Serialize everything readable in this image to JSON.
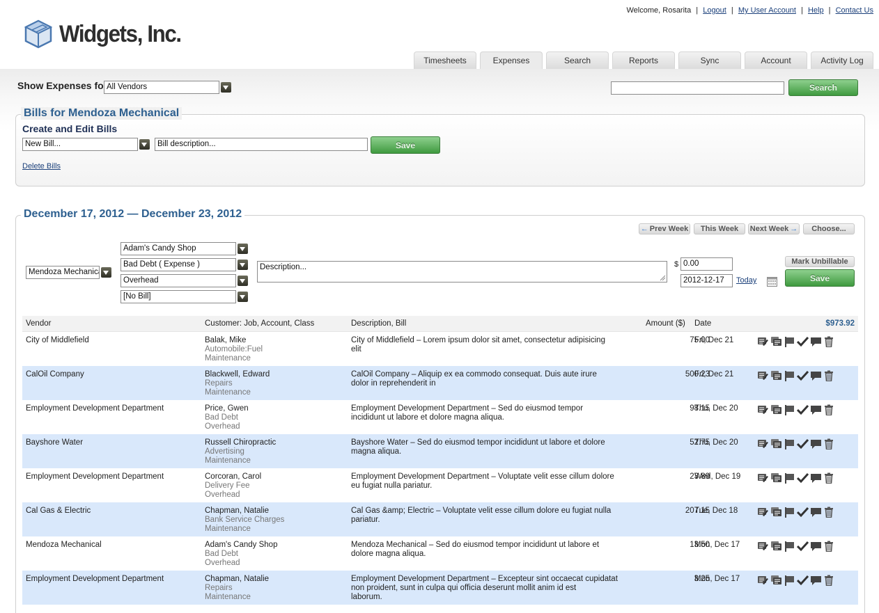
{
  "header": {
    "brand": "Widgets, Inc.",
    "welcome": "Welcome, Rosarita",
    "links": [
      "Logout",
      "My User Account",
      "Help",
      "Contact Us"
    ],
    "tabs": [
      "Timesheets",
      "Expenses",
      "Search",
      "Reports",
      "Sync",
      "Account",
      "Activity Log"
    ],
    "active_tab": "Expenses"
  },
  "filter": {
    "label": "Show Expenses for",
    "vendor_value": "All Vendors",
    "search_value": "",
    "search_button": "Search"
  },
  "bills": {
    "title": "Bills for Mendoza Mechanical",
    "subtitle": "Create and Edit Bills",
    "bill_select": "New Bill...",
    "description_placeholder": "Bill description...",
    "save_button": "Save",
    "delete_link": "Delete Bills"
  },
  "week": {
    "title": "December 17, 2012 — December 23, 2012",
    "prev": "Prev Week",
    "this": "This Week",
    "next": "Next Week",
    "choose": "Choose..."
  },
  "entry": {
    "vendor": "Mendoza Mechanical",
    "customer": "Adam's Candy Shop",
    "account": "Bad Debt ( Expense )",
    "class": "Overhead",
    "bill": "[No Bill]",
    "description_placeholder": "Description...",
    "currency": "$",
    "amount": "0.00",
    "date": "2012-12-17",
    "today": "Today",
    "mark_unbillable": "Mark Unbillable",
    "save": "Save"
  },
  "table": {
    "headers": {
      "vendor": "Vendor",
      "customer": "Customer: Job, Account, Class",
      "description": "Description, Bill",
      "amount": "Amount ($)",
      "date": "Date",
      "total": "$973.92"
    },
    "rows": [
      {
        "vendor": "City of Middlefield",
        "customer": "Balak, Mike",
        "account": "Automobile:Fuel",
        "class": "Maintenance",
        "desc1": "City of Middlefield – Lorem ipsum dolor sit amet, consectetur adipisicing",
        "desc2": "elit",
        "desc3": "",
        "amount": "75.00",
        "date": "Fri, Dec 21"
      },
      {
        "vendor": "CalOil Company",
        "customer": "Blackwell, Edward",
        "account": "Repairs",
        "class": "Maintenance",
        "desc1": "CalOil Company – Aliquip ex ea commodo consequat. Duis aute irure",
        "desc2": "dolor in reprehenderit in",
        "desc3": "",
        "amount": "500.23",
        "date": "Fri, Dec 21"
      },
      {
        "vendor": "Employment Development Department",
        "customer": "Price, Gwen",
        "account": "Bad Debt",
        "class": "Overhead",
        "desc1": "Employment Development Department – Sed do eiusmod tempor",
        "desc2": "incididunt ut labore et dolore magna aliqua.",
        "desc3": "",
        "amount": "98.15",
        "date": "Thu, Dec 20"
      },
      {
        "vendor": "Bayshore Water",
        "customer": "Russell Chiropractic",
        "account": "Advertising",
        "class": "Maintenance",
        "desc1": "Bayshore Water – Sed do eiusmod tempor incididunt ut labore et dolore",
        "desc2": "magna aliqua.",
        "desc3": "",
        "amount": "52.75",
        "date": "Thu, Dec 20"
      },
      {
        "vendor": "Employment Development Department",
        "customer": "Corcoran, Carol",
        "account": "Delivery Fee",
        "class": "Overhead",
        "desc1": "Employment Development Department – Voluptate velit esse cillum dolore",
        "desc2": "eu fugiat nulla pariatur.",
        "desc3": "",
        "amount": "23.89",
        "date": "Wed, Dec 19"
      },
      {
        "vendor": "Cal Gas & Electric",
        "customer": "Chapman, Natalie",
        "account": "Bank Service Charges",
        "class": "Maintenance",
        "desc1": "Cal Gas &amp; Electric – Voluptate velit esse cillum dolore eu fugiat nulla",
        "desc2": "pariatur.",
        "desc3": "",
        "amount": "207.15",
        "date": "Tue, Dec 18"
      },
      {
        "vendor": "Mendoza Mechanical",
        "customer": "Adam's Candy Shop",
        "account": "Bad Debt",
        "class": "Overhead",
        "desc1": "Mendoza Mechanical – Sed do eiusmod tempor incididunt ut labore et",
        "desc2": "dolore magna aliqua.",
        "desc3": "",
        "amount": "13.50",
        "date": "Mon, Dec 17"
      },
      {
        "vendor": "Employment Development Department",
        "customer": "Chapman, Natalie",
        "account": "Repairs",
        "class": "Maintenance",
        "desc1": "Employment Development Department – Excepteur sint occaecat cupidatat",
        "desc2": "non proident, sunt in culpa qui officia deserunt mollit anim id est",
        "desc3": "laborum.",
        "amount": "3.25",
        "date": "Mon, Dec 17"
      }
    ]
  },
  "colors": {
    "accent": "#2d5f8f",
    "row_alt": "#d9e8fb",
    "button_green": "#4fa64f",
    "link": "#1a3f7a"
  }
}
